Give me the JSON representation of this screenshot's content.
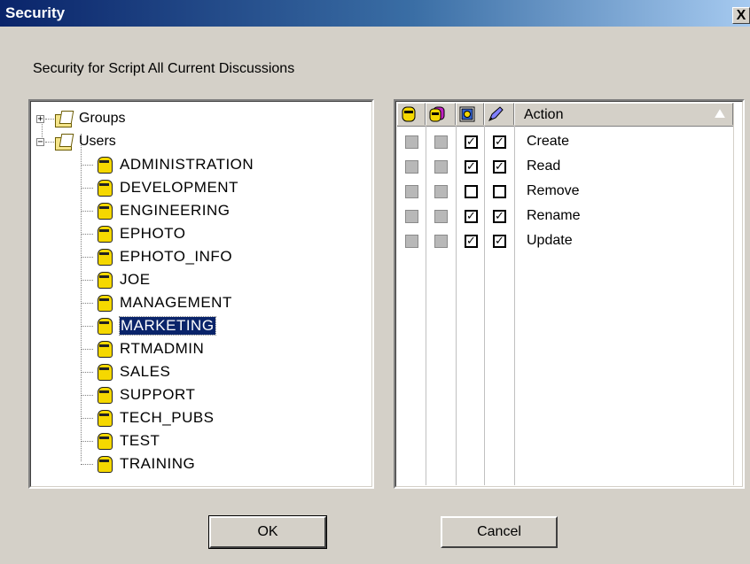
{
  "window": {
    "title": "Security",
    "close_glyph": "X"
  },
  "caption": "Security for Script All Current Discussions",
  "tree": {
    "groups": {
      "label": "Groups",
      "expander": "+"
    },
    "users": {
      "label": "Users",
      "expander": "−"
    },
    "user_items": [
      "ADMINISTRATION",
      "DEVELOPMENT",
      "ENGINEERING",
      "EPHOTO",
      "EPHOTO_INFO",
      "JOE",
      "MANAGEMENT",
      "MARKETING",
      "RTMADMIN",
      "SALES",
      "SUPPORT",
      "TECH_PUBS",
      "TEST",
      "TRAINING"
    ],
    "selected": "MARKETING"
  },
  "actions": {
    "header": {
      "action_label": "Action",
      "columns": [
        "user-icon",
        "group-icon",
        "permission-icon",
        "edit-icon"
      ]
    },
    "rows": [
      {
        "label": "Create",
        "col3": "☑",
        "col4": "☑"
      },
      {
        "label": "Read",
        "col3": "☑",
        "col4": "☑"
      },
      {
        "label": "Remove",
        "col3": "",
        "col4": ""
      },
      {
        "label": "Rename",
        "col3": "☑",
        "col4": "☑"
      },
      {
        "label": "Update",
        "col3": "☑",
        "col4": "☑"
      }
    ]
  },
  "buttons": {
    "ok": "OK",
    "cancel": "Cancel"
  }
}
